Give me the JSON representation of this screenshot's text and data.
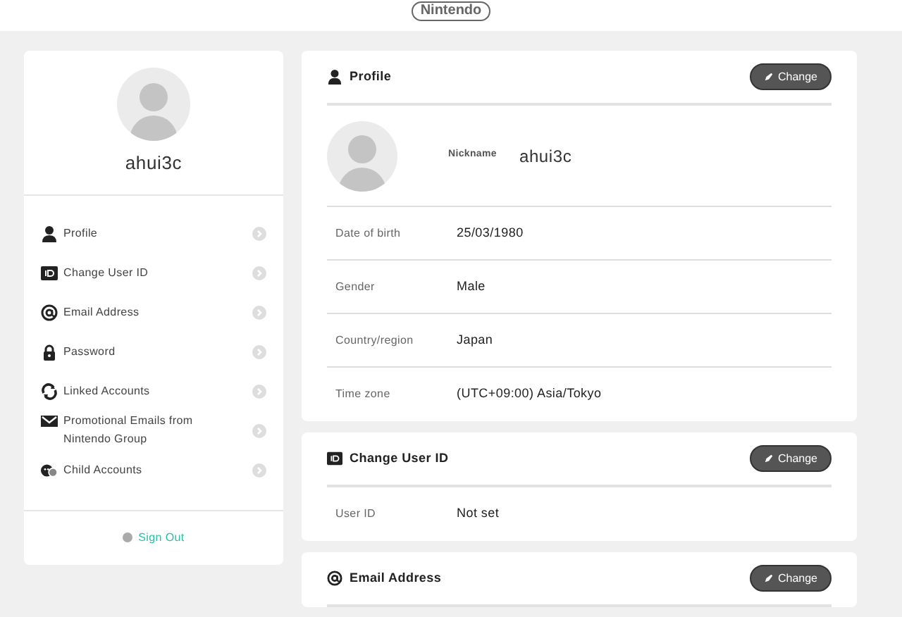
{
  "header": {
    "logo": "Nintendo"
  },
  "account_card": {
    "nickname": "ahui3c",
    "menu": [
      {
        "label": "Profile",
        "kind": "person"
      },
      {
        "label": "Change User ID",
        "kind": "id"
      },
      {
        "label": "Email Address",
        "kind": "at"
      },
      {
        "label": "Password",
        "kind": "lock"
      },
      {
        "label": "Linked Accounts",
        "kind": "link"
      },
      {
        "label": "Promotional Emails from Nintendo Group",
        "kind": "mail"
      },
      {
        "label": "Child Accounts",
        "kind": "child"
      }
    ],
    "sign_out": "Sign Out"
  },
  "sections": [
    {
      "title": "Profile",
      "kind": "person",
      "button": "Change",
      "nickname_label": "Nickname",
      "nickname": "ahui3c",
      "fields": [
        {
          "label": "Date of birth",
          "value": "25/03/1980"
        },
        {
          "label": "Gender",
          "value": "Male"
        },
        {
          "label": "Country/region",
          "value": "Japan"
        },
        {
          "label": "Time zone",
          "value": "(UTC+09:00) Asia/Tokyo"
        }
      ]
    },
    {
      "title": "Change User ID",
      "kind": "id",
      "button": "Change",
      "fields": [
        {
          "label": "User ID",
          "value": "Not set"
        }
      ]
    },
    {
      "title": "Email Address",
      "kind": "at",
      "button": "Change"
    }
  ]
}
